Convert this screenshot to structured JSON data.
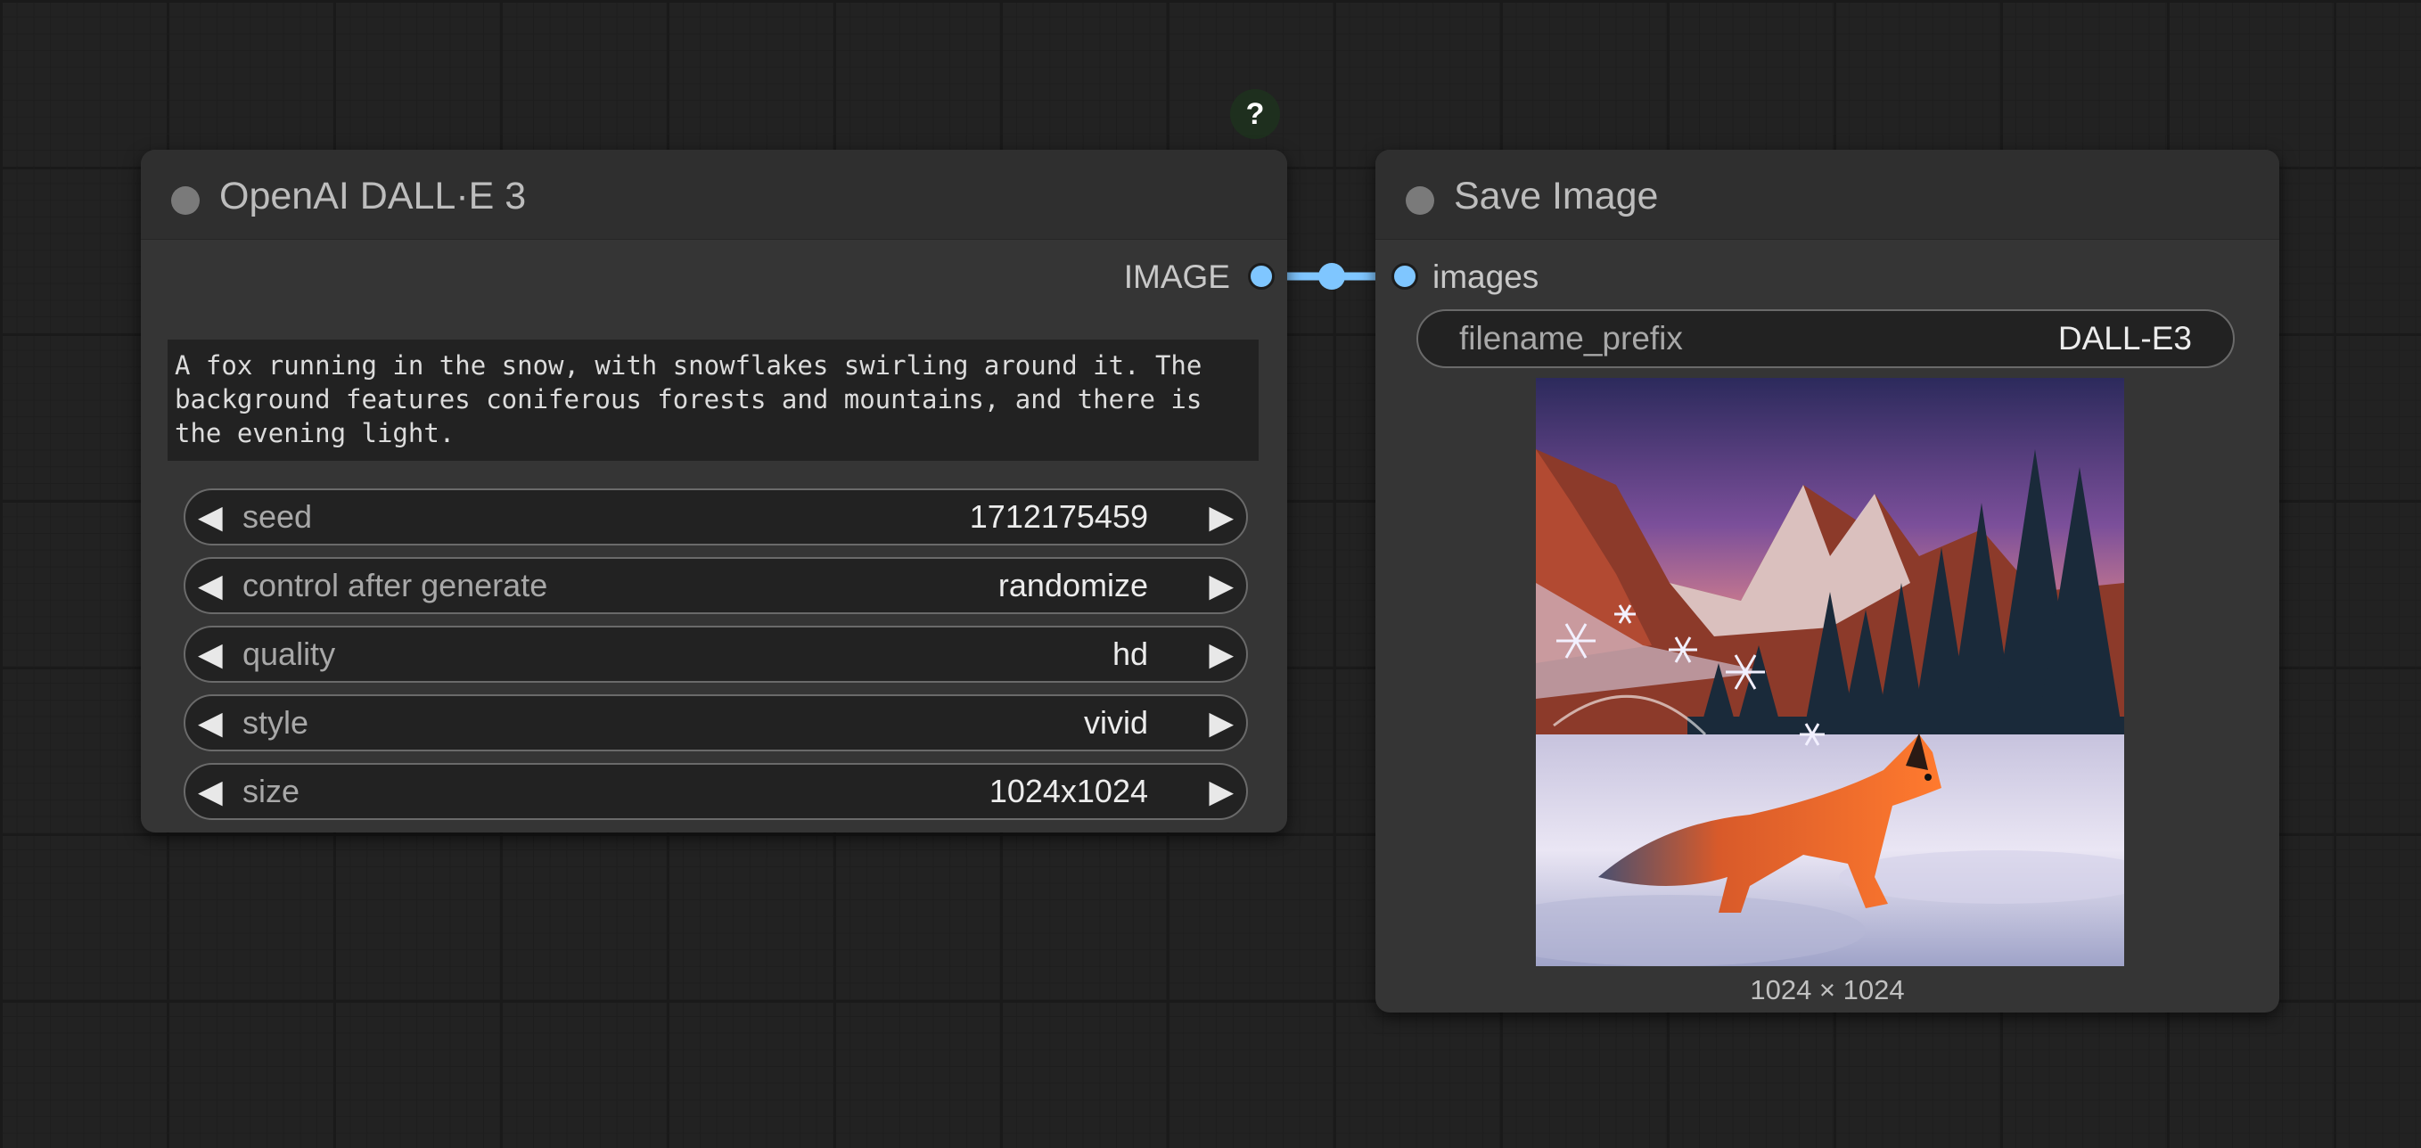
{
  "help": {
    "label": "?"
  },
  "dalle_node": {
    "title": "OpenAI DALL·E 3",
    "output_label": "IMAGE",
    "prompt": "A fox running in the snow, with snowflakes swirling around it. The\nbackground features coniferous forests and mountains, and there is\nthe evening light.",
    "widgets": [
      {
        "label": "seed",
        "value": "1712175459"
      },
      {
        "label": "control after generate",
        "value": "randomize"
      },
      {
        "label": "quality",
        "value": "hd"
      },
      {
        "label": "style",
        "value": "vivid"
      },
      {
        "label": "size",
        "value": "1024x1024"
      }
    ],
    "arrow_left": "◀",
    "arrow_right": "▶"
  },
  "save_node": {
    "title": "Save Image",
    "input_label": "images",
    "filename_prefix": {
      "label": "filename_prefix",
      "value": "DALL-E3"
    },
    "image_size": "1024 × 1024"
  },
  "colors": {
    "link": "#7fc6ff",
    "node_bg": "#353535",
    "header_bg": "#2f2f2f"
  }
}
